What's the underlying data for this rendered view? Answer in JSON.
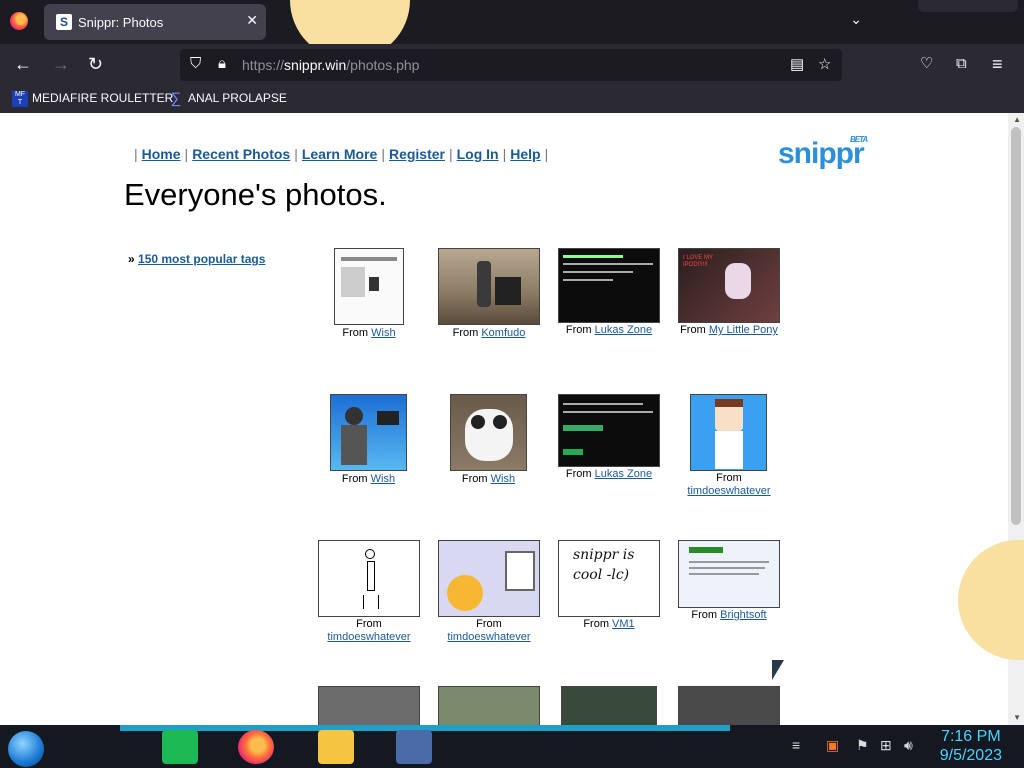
{
  "browser": {
    "tab_title": "Snippr: Photos",
    "tab_favicon": "S",
    "url_prefix": "https://",
    "url_host": "snippr.win",
    "url_path": "/photos.php",
    "bookmarks": [
      {
        "label": "MEDIAFIRE ROULETTER",
        "icon": "mediafire-icon"
      },
      {
        "label": "ANAL PROLAPSE",
        "icon": "sigma-icon"
      }
    ]
  },
  "site": {
    "nav": [
      "Home",
      "Recent Photos",
      "Learn More",
      "Register",
      "Log In",
      "Help"
    ],
    "logo": "snippr",
    "logo_beta": "BETA",
    "title": "Everyone's photos.",
    "tags_prefix": "»",
    "tags_link": "150 most popular tags"
  },
  "photos": [
    {
      "from": "From",
      "source": "Wish"
    },
    {
      "from": "From",
      "source": "Komfudo"
    },
    {
      "from": "From",
      "source": "Lukas Zone"
    },
    {
      "from": "From",
      "source": "My Little Pony",
      "thumb_text": "I LOVE MY IPOD!!!!!!"
    },
    {
      "from": "From",
      "source": "Wish"
    },
    {
      "from": "From",
      "source": "Wish"
    },
    {
      "from": "From",
      "source": "Lukas Zone"
    },
    {
      "from": "From",
      "source": "timdoeswhatever"
    },
    {
      "from": "From",
      "source": "timdoeswhatever"
    },
    {
      "from": "From",
      "source": "timdoeswhatever"
    },
    {
      "from": "From",
      "source": "VM1",
      "thumb_text": "snippr is cool -lc)"
    },
    {
      "from": "From",
      "source": "Brightsoft"
    }
  ],
  "taskbar": {
    "time": "7:16 PM",
    "date": "9/5/2023"
  }
}
